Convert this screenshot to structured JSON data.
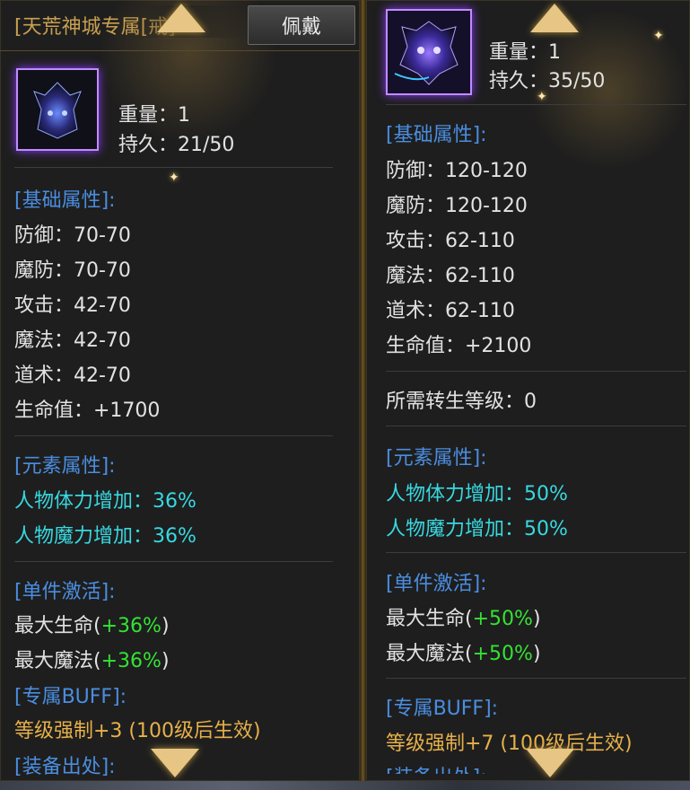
{
  "left": {
    "title": "[天荒神城专属[戒]",
    "wear_button": "佩戴",
    "item_icon": "demon-helmet-icon",
    "weight": "重量：1",
    "durability": "持久：21/50",
    "basic_header": "[基础属性]:",
    "basic": [
      "防御：70-70",
      "魔防：70-70",
      "攻击：42-70",
      "魔法：42-70",
      "道术：42-70",
      "生命值：+1700"
    ],
    "element_header": "[元素属性]:",
    "element": [
      "人物体力增加：36%",
      "人物魔力增加：36%"
    ],
    "activation_header": "[单件激活]:",
    "activation": [
      {
        "name": "最大生命(",
        "value": "+36%",
        "close": ")"
      },
      {
        "name": "最大魔法(",
        "value": "+36%",
        "close": ")"
      }
    ],
    "buff_header": "[专属BUFF]:",
    "buff": "等级强制+3 (100级后生效)",
    "source_header": "[装备出处]:"
  },
  "right": {
    "item_icon": "demon-mask-icon",
    "weight": "重量：1",
    "durability": "持久：35/50",
    "basic_header": "[基础属性]:",
    "basic": [
      "防御：120-120",
      "魔防：120-120",
      "攻击：62-110",
      "魔法：62-110",
      "道术：62-110",
      "生命值：+2100"
    ],
    "rebirth": "所需转生等级：0",
    "element_header": "[元素属性]:",
    "element": [
      "人物体力增加：50%",
      "人物魔力增加：50%"
    ],
    "activation_header": "[单件激活]:",
    "activation": [
      {
        "name": "最大生命(",
        "value": "+50%",
        "close": ")"
      },
      {
        "name": "最大魔法(",
        "value": "+50%",
        "close": ")"
      }
    ],
    "buff_header": "[专属BUFF]:",
    "buff": "等级强制+7 (100级后生效)",
    "source_header": "[装备出处]:"
  },
  "colors": {
    "section_header": "#4a8ee0",
    "element": "#38d8e0",
    "bonus": "#34e234",
    "buff": "#e6b04a",
    "icon_border": "#c08cff"
  }
}
